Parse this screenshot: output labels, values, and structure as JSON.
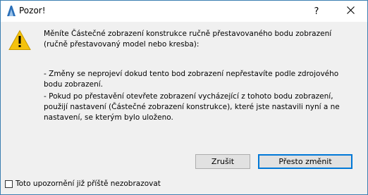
{
  "window": {
    "title": "Pozor!",
    "help_glyph": "?",
    "close_glyph": "✕"
  },
  "icons": {
    "app": "archicad-app-icon",
    "warning": "warning-triangle-icon",
    "accent_color": "#f4c20d"
  },
  "message": {
    "line1": "Měníte Částečné zobrazení konstrukce ručně přestavovaného bodu zobrazení (ručně přestavovaný model nebo kresba):",
    "line2": "- Změny se neprojeví dokud tento bod zobrazení nepřestavíte podle zdrojového bodu zobrazení.",
    "line3": "- Pokud po přestavění otevřete zobrazení vycházející z tohoto bodu zobrazení, použijí nastavení (Částečné zobrazení konstrukce), které jste nastavili nyní a ne nastavení, se kterým bylo uloženo."
  },
  "buttons": {
    "cancel": "Zrušit",
    "ok": "Přesto změnit"
  },
  "footer": {
    "checkbox_label": "Toto upozornění již příště nezobrazovat",
    "checkbox_checked": false
  }
}
